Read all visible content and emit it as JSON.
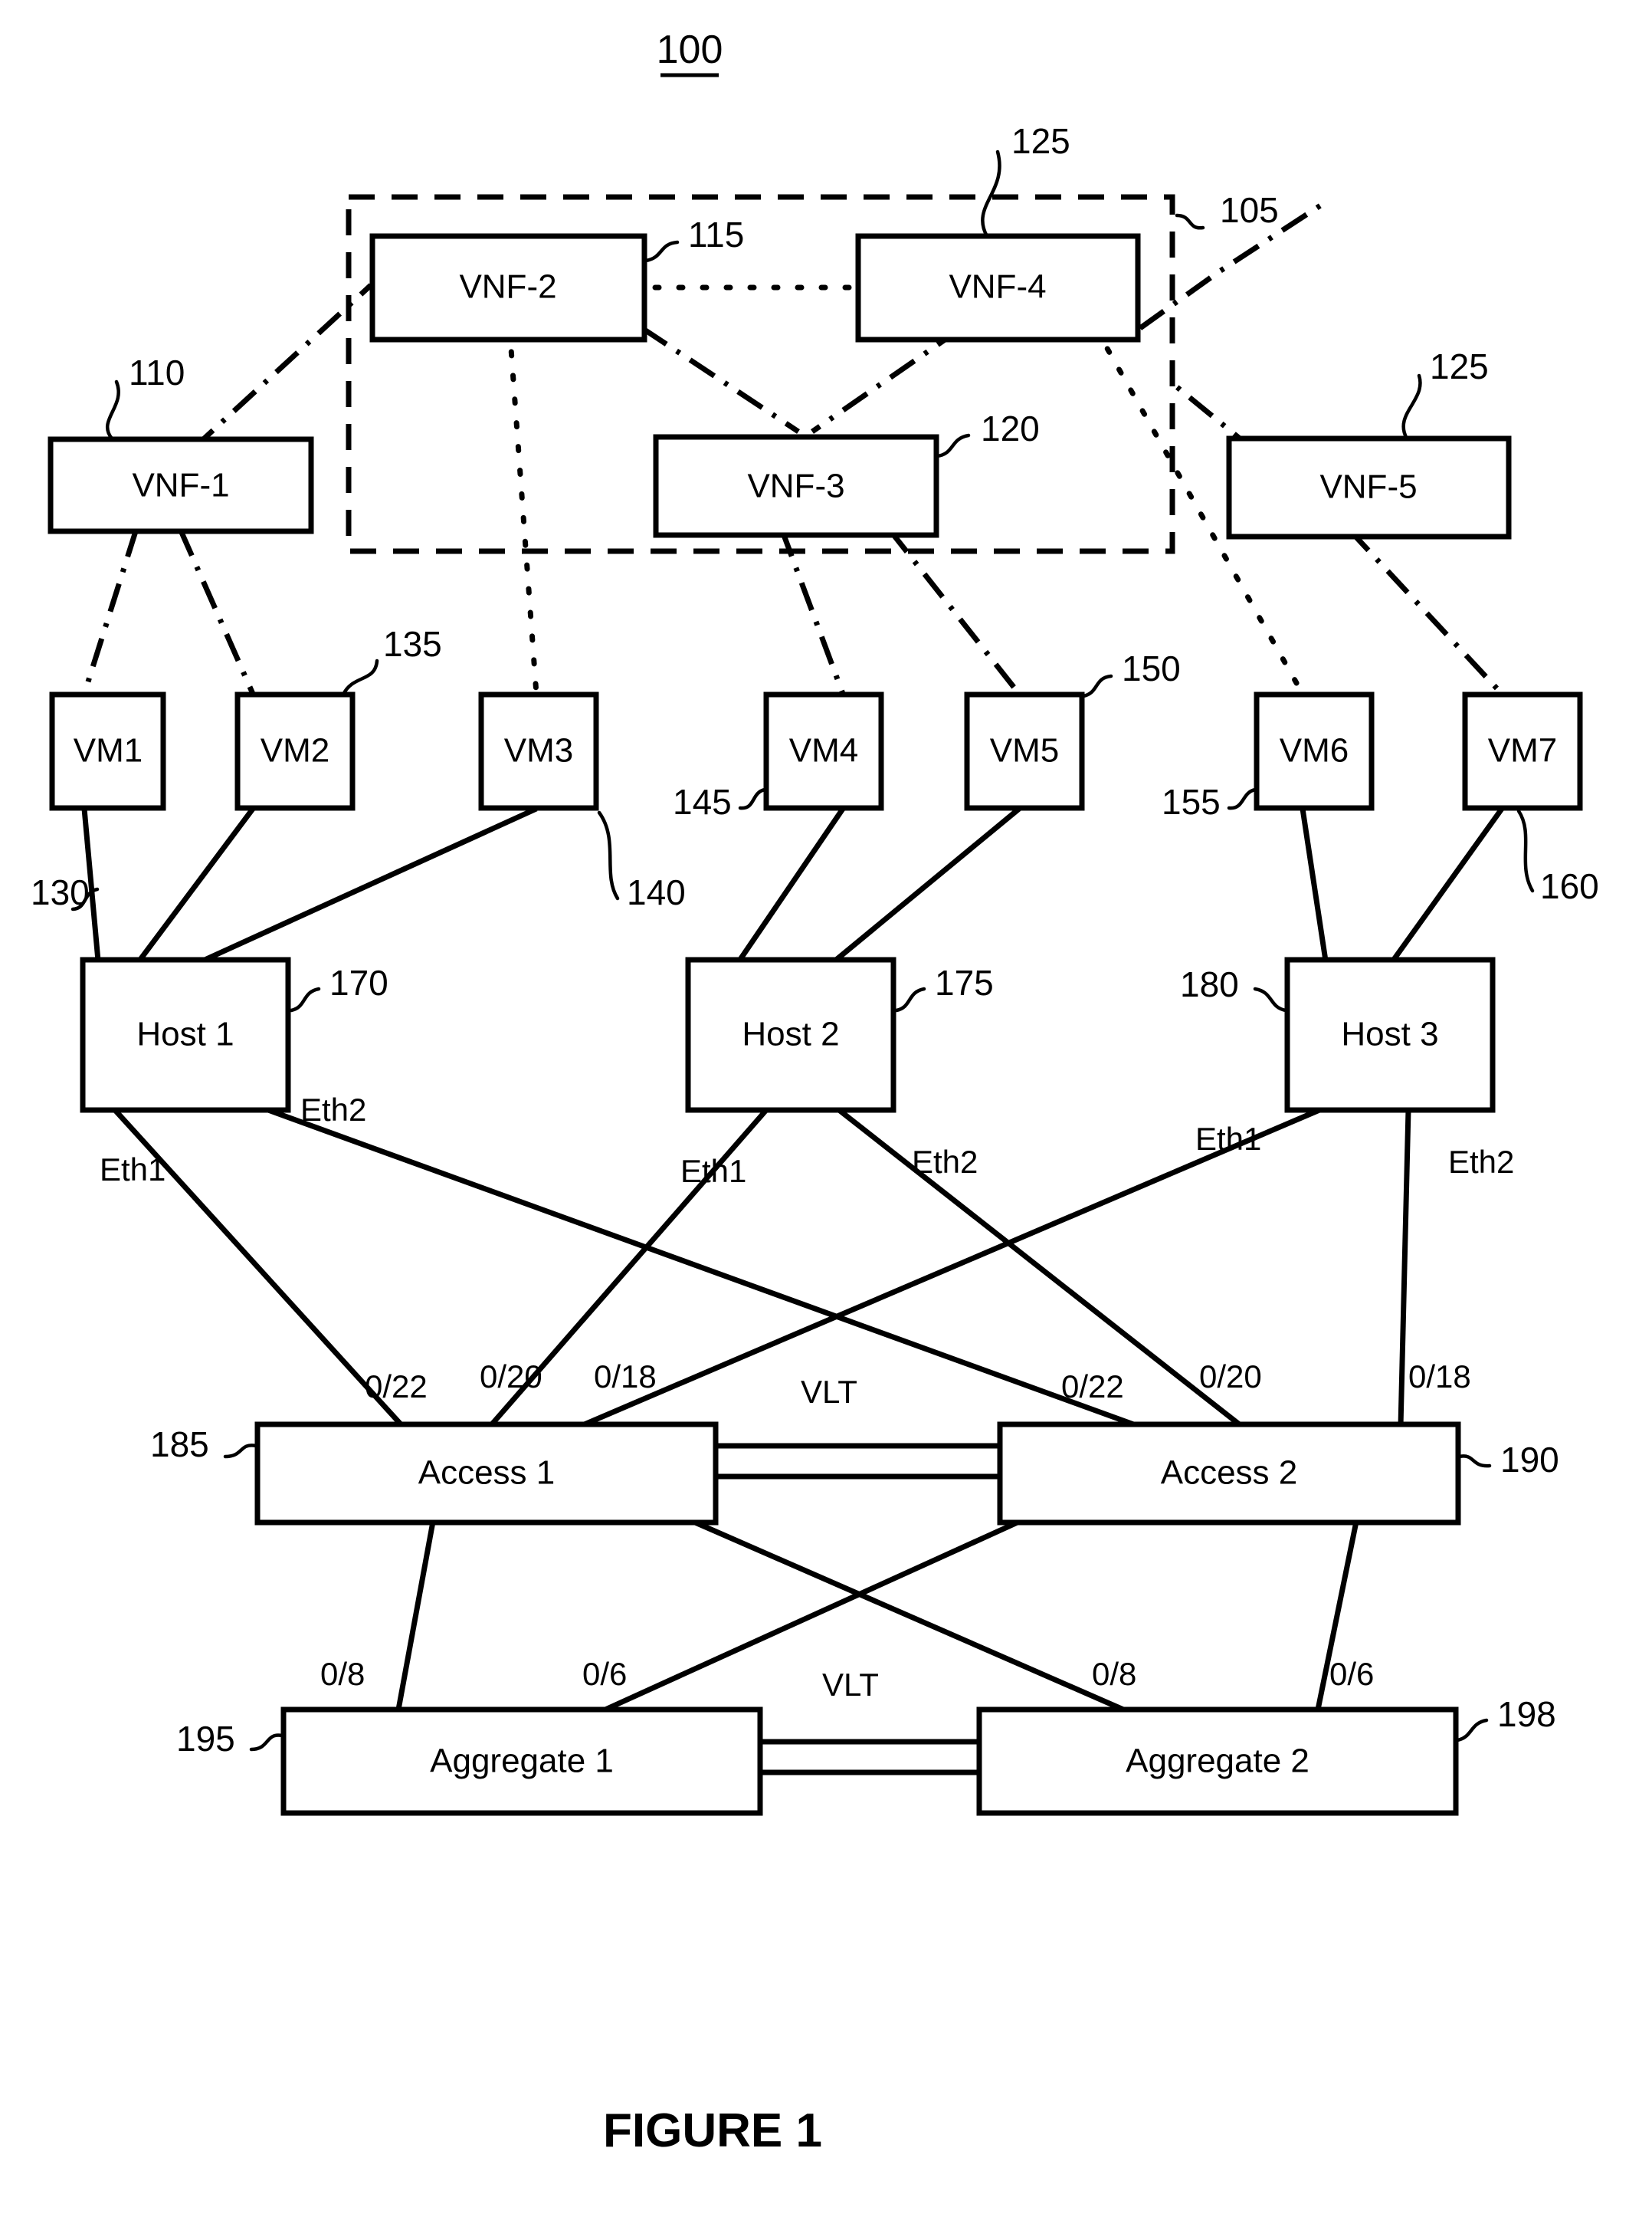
{
  "figure": {
    "top_ref": "100",
    "caption": "FIGURE 1"
  },
  "group": {
    "ref": "105",
    "name": "vnf-group-boundary"
  },
  "vnfs": [
    {
      "label": "VNF-1",
      "ref": "110"
    },
    {
      "label": "VNF-2",
      "ref": "115"
    },
    {
      "label": "VNF-3",
      "ref": "120"
    },
    {
      "label": "VNF-4",
      "ref": "125"
    },
    {
      "label": "VNF-5",
      "ref": "125"
    }
  ],
  "vms": [
    {
      "label": "VM1",
      "ref": "130"
    },
    {
      "label": "VM2",
      "ref": "135"
    },
    {
      "label": "VM3",
      "ref": "140"
    },
    {
      "label": "VM4",
      "ref": "145"
    },
    {
      "label": "VM5",
      "ref": "150"
    },
    {
      "label": "VM6",
      "ref": "155"
    },
    {
      "label": "VM7",
      "ref": "160"
    }
  ],
  "hosts": [
    {
      "label": "Host 1",
      "ref": "170",
      "eth1": "Eth1",
      "eth2": "Eth2"
    },
    {
      "label": "Host 2",
      "ref": "175",
      "eth1": "Eth1",
      "eth2": "Eth2"
    },
    {
      "label": "Host 3",
      "ref": "180",
      "eth1": "Eth1",
      "eth2": "Eth2"
    }
  ],
  "access_switches": [
    {
      "label": "Access 1",
      "ref": "185",
      "ports": [
        "0/22",
        "0/20",
        "0/18"
      ]
    },
    {
      "label": "Access 2",
      "ref": "190",
      "ports": [
        "0/22",
        "0/20",
        "0/18"
      ]
    }
  ],
  "aggregate_switches": [
    {
      "label": "Aggregate 1",
      "ref": "195",
      "ports": [
        "0/8",
        "0/6"
      ]
    },
    {
      "label": "Aggregate 2",
      "ref": "198",
      "ports": [
        "0/8",
        "0/6"
      ]
    }
  ],
  "vlt_links": [
    {
      "label": "VLT",
      "tier": "access"
    },
    {
      "label": "VLT",
      "tier": "aggregate"
    }
  ],
  "colors": {
    "stroke": "#000000",
    "background": "#ffffff"
  }
}
